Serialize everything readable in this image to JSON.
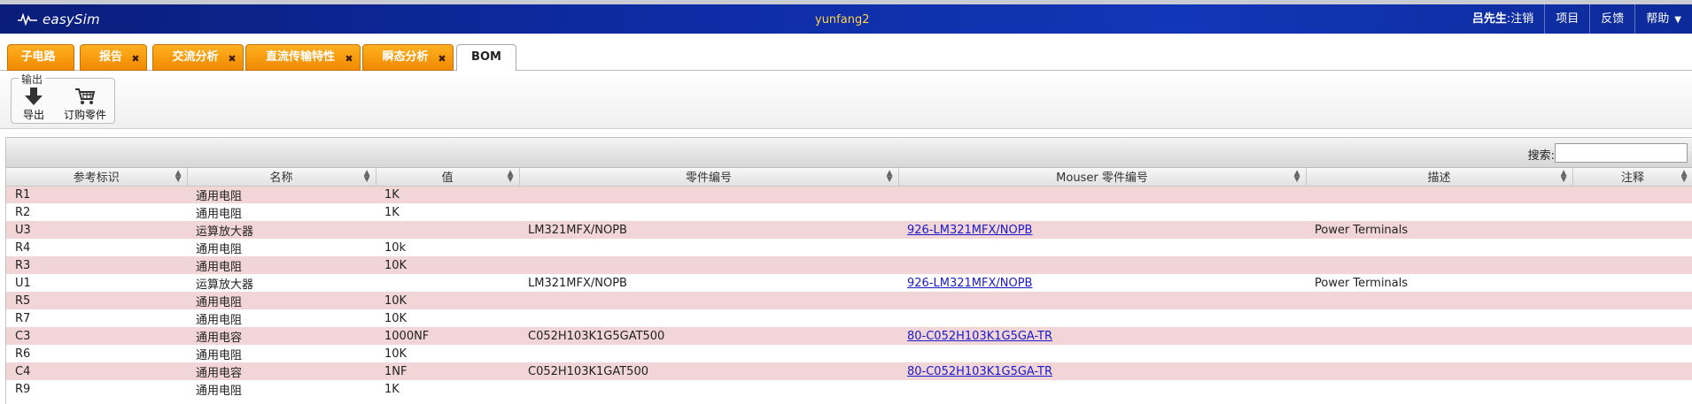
{
  "app": {
    "logo_text": "easySim"
  },
  "header": {
    "user_center": "yunfang2",
    "user_label": "吕先生",
    "logout": ":注销",
    "project": "项目",
    "feedback": "反馈",
    "help": "帮助"
  },
  "tabs": [
    {
      "label": "子电路",
      "closable": false
    },
    {
      "label": "报告",
      "closable": true
    },
    {
      "label": "交流分析",
      "closable": true
    },
    {
      "label": "直流传输特性",
      "closable": true
    },
    {
      "label": "瞬态分析",
      "closable": true
    },
    {
      "label": "BOM",
      "closable": false,
      "active": true
    }
  ],
  "toolbar": {
    "group_title": "输出",
    "export_label": "导出",
    "order_label": "订购零件"
  },
  "search": {
    "label": "搜索:",
    "value": ""
  },
  "table": {
    "columns": [
      "参考标识",
      "名称",
      "值",
      "零件编号",
      "Mouser 零件编号",
      "描述",
      "注释"
    ],
    "rows": [
      [
        "R1",
        "通用电阻",
        "1K",
        "",
        "",
        "",
        ""
      ],
      [
        "R2",
        "通用电阻",
        "1K",
        "",
        "",
        "",
        ""
      ],
      [
        "U3",
        "运算放大器",
        "",
        "LM321MFX/NOPB",
        "926-LM321MFX/NOPB",
        "Power Terminals",
        ""
      ],
      [
        "R4",
        "通用电阻",
        "10k",
        "",
        "",
        "",
        ""
      ],
      [
        "R3",
        "通用电阻",
        "10K",
        "",
        "",
        "",
        ""
      ],
      [
        "U1",
        "运算放大器",
        "",
        "LM321MFX/NOPB",
        "926-LM321MFX/NOPB",
        "Power Terminals",
        ""
      ],
      [
        "R5",
        "通用电阻",
        "10K",
        "",
        "",
        "",
        ""
      ],
      [
        "R7",
        "通用电阻",
        "10K",
        "",
        "",
        "",
        ""
      ],
      [
        "C3",
        "通用电容",
        "1000NF",
        "C052H103K1G5GAT500",
        "80-C052H103K1G5GA-TR",
        "",
        ""
      ],
      [
        "R6",
        "通用电阻",
        "10K",
        "",
        "",
        "",
        ""
      ],
      [
        "C4",
        "通用电容",
        "1NF",
        "C052H103K1GAT500",
        "80-C052H103K1G5GA-TR",
        "",
        ""
      ],
      [
        "R9",
        "通用电阻",
        "1K",
        "",
        "",
        "",
        ""
      ]
    ]
  },
  "colors": {
    "header_bg": "#0d2aa0",
    "tab_orange": "#f7a012",
    "row_alt": "#f2d5d6",
    "link": "#1a1acc",
    "username": "#ffd24a"
  }
}
